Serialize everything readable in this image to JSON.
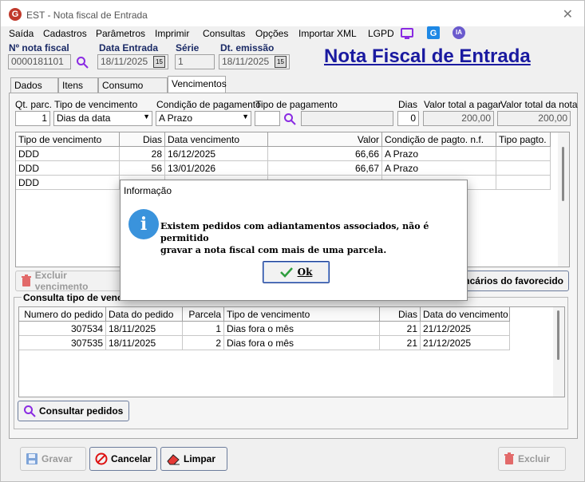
{
  "window": {
    "title": "EST - Nota fiscal de Entrada",
    "logo_letter": "G"
  },
  "menu": [
    "Saída",
    "Cadastros",
    "Parâmetros",
    "Imprimir",
    "Consultas",
    "Opções",
    "Importar XML",
    "LGPD"
  ],
  "menu_icons": {
    "ia_label": "IA"
  },
  "header": {
    "nf_label": "Nº nota fiscal",
    "nf_value": "0000181101",
    "entrada_label": "Data Entrada",
    "entrada_value": "18/11/2025",
    "serie_label": "Série",
    "serie_value": "1",
    "emissao_label": "Dt. emissão",
    "emissao_value": "18/11/2025",
    "big_title": "Nota Fiscal de Entrada",
    "cal_label": "15"
  },
  "tabs": [
    "Dados NF",
    "Itens NF",
    "Consumo direto",
    "Vencimentos"
  ],
  "form": {
    "qt_label": "Qt. parc.",
    "qt_value": "1",
    "tipo_venc_label": "Tipo de vencimento",
    "tipo_venc_value": "Dias da data",
    "cond_label": "Condição de pagamento",
    "cond_value": "A Prazo",
    "tipo_pag_label": "Tipo de pagamento",
    "tipo_pag_value": "",
    "dias_label": "Dias",
    "dias_value": "0",
    "valor_pagar_label": "Valor total a pagar",
    "valor_pagar_value": "200,00",
    "valor_nota_label": "Valor total da nota",
    "valor_nota_value": "200,00"
  },
  "venc_table": {
    "headers": [
      "Tipo de vencimento",
      "Dias",
      "Data vencimento",
      "Valor",
      "Condição de pagto. n.f.",
      "Tipo pagto."
    ],
    "rows": [
      [
        "DDD",
        "28",
        "16/12/2025",
        "66,66",
        "A Prazo",
        ""
      ],
      [
        "DDD",
        "56",
        "13/01/2026",
        "66,67",
        "A Prazo",
        ""
      ],
      [
        "DDD",
        "",
        "",
        "",
        "",
        ""
      ]
    ]
  },
  "buttons": {
    "excluir_vencimento": "Excluir vencimento",
    "bancarios": "ncários do favorecido",
    "consultar_pedidos": "Consultar pedidos",
    "gravar": "Gravar",
    "cancelar": "Cancelar",
    "limpar": "Limpar",
    "excluir": "Excluir"
  },
  "consulta": {
    "group_title": "Consulta tipo de venc",
    "headers": [
      "Numero do pedido",
      "Data do pedido",
      "Parcela",
      "Tipo de vencimento",
      "Dias",
      "Data do vencimento"
    ],
    "rows": [
      [
        "307534",
        "18/11/2025",
        "1",
        "Dias fora o mês",
        "21",
        "21/12/2025"
      ],
      [
        "307535",
        "18/11/2025",
        "2",
        "Dias fora o mês",
        "21",
        "21/12/2025"
      ]
    ]
  },
  "dialog": {
    "title": "Informação",
    "message_line1": "Existem pedidos com adiantamentos associados, não é permitido",
    "message_line2": "gravar a nota fiscal com mais de uma parcela.",
    "ok_label": "Ok",
    "icon_glyph": "i"
  }
}
